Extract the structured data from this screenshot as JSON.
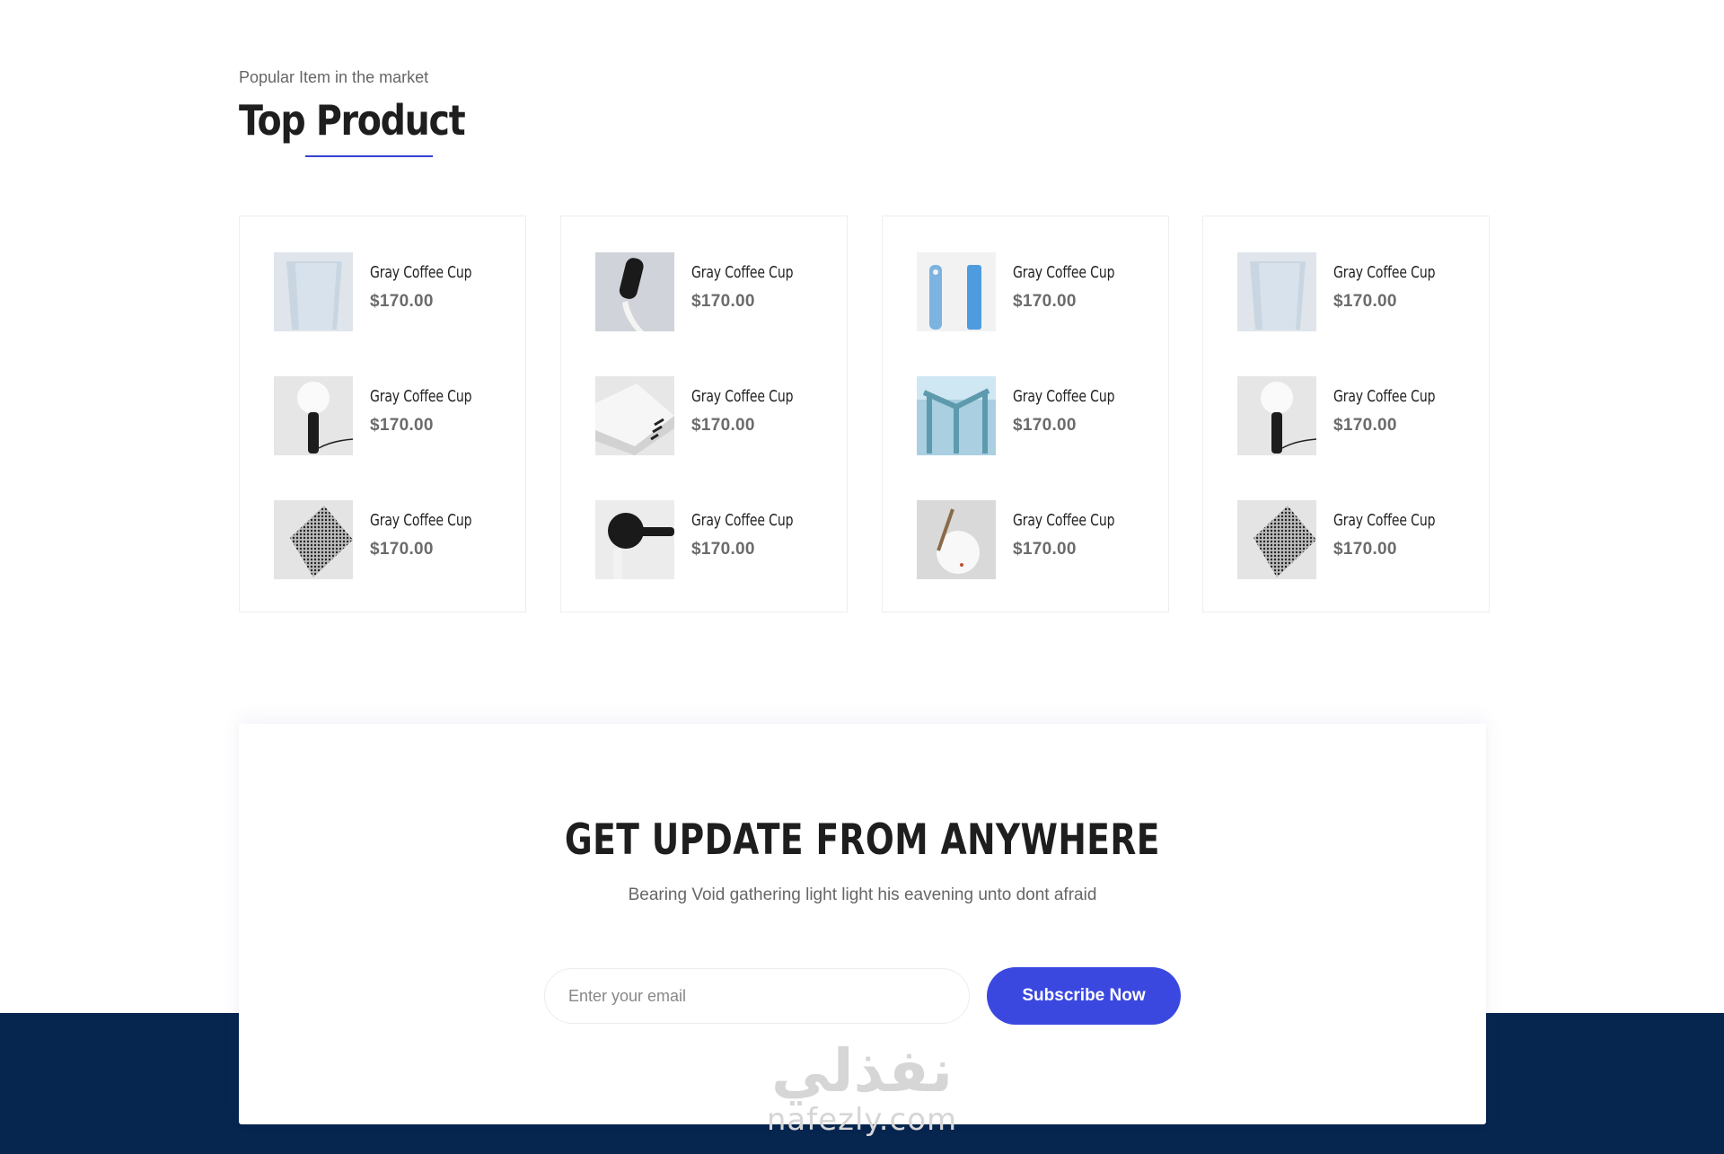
{
  "section": {
    "subtitle": "Popular Item in the market",
    "title": "Top Product",
    "accent_color": "#3641d6"
  },
  "cards": [
    {
      "items": [
        {
          "name": "Gray Coffee Cup",
          "price": "$170.00",
          "image": "gray-cup"
        },
        {
          "name": "Gray Coffee Cup",
          "price": "$170.00",
          "image": "globe-lamp"
        },
        {
          "name": "Gray Coffee Cup",
          "price": "$170.00",
          "image": "patterned-cloth"
        }
      ]
    },
    {
      "items": [
        {
          "name": "Gray Coffee Cup",
          "price": "$170.00",
          "image": "toothbrush"
        },
        {
          "name": "Gray Coffee Cup",
          "price": "$170.00",
          "image": "white-holder"
        },
        {
          "name": "Gray Coffee Cup",
          "price": "$170.00",
          "image": "black-hook"
        }
      ]
    },
    {
      "items": [
        {
          "name": "Gray Coffee Cup",
          "price": "$170.00",
          "image": "blue-tubes"
        },
        {
          "name": "Gray Coffee Cup",
          "price": "$170.00",
          "image": "glass-stand"
        },
        {
          "name": "Gray Coffee Cup",
          "price": "$170.00",
          "image": "white-ball"
        }
      ]
    },
    {
      "items": [
        {
          "name": "Gray Coffee Cup",
          "price": "$170.00",
          "image": "gray-cup"
        },
        {
          "name": "Gray Coffee Cup",
          "price": "$170.00",
          "image": "globe-lamp"
        },
        {
          "name": "Gray Coffee Cup",
          "price": "$170.00",
          "image": "patterned-cloth"
        }
      ]
    }
  ],
  "subscribe": {
    "title": "GET UPDATE FROM ANYWHERE",
    "description": "Bearing Void gathering light light his eavening unto dont afraid",
    "email_placeholder": "Enter your email",
    "button_label": "Subscribe Now",
    "button_color": "#3b48e0"
  },
  "footer": {
    "background_color": "#06264f"
  },
  "watermark": {
    "arabic": "نفذلي",
    "latin": "nafezly.com"
  }
}
